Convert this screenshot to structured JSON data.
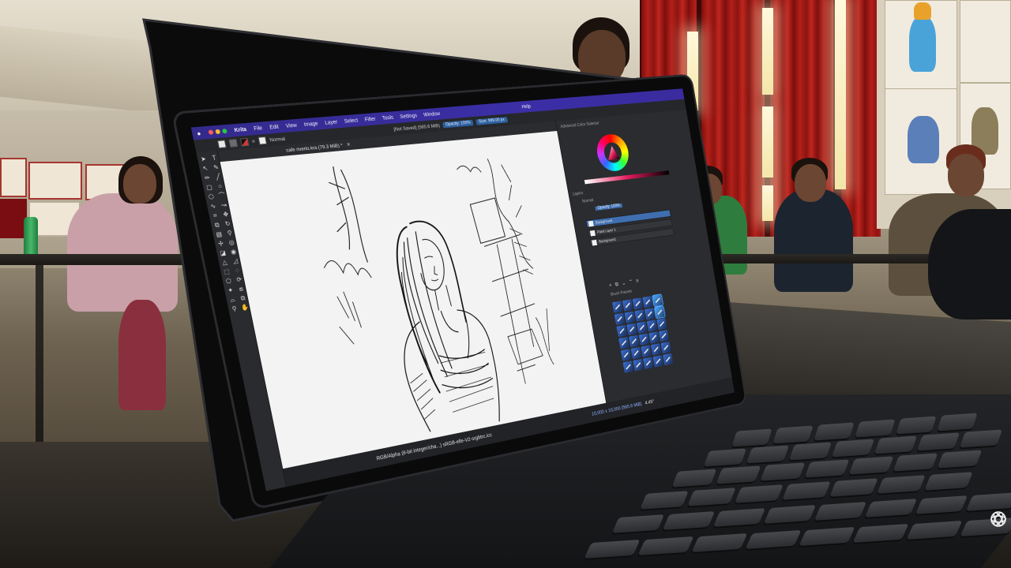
{
  "krita": {
    "menubar": {
      "apple_icon": "apple-logo-icon",
      "items": [
        "Krita",
        "File",
        "Edit",
        "View",
        "Image",
        "Layer",
        "Select",
        "Filter",
        "Tools",
        "Settings",
        "Window",
        "Help"
      ]
    },
    "toolbar": {
      "blend_mode": "Normal",
      "doc_status": "[Not Saved]  (565.6 MiB)",
      "opacity": "Opacity: 100%",
      "size": "Size: 999.00 px"
    },
    "document": {
      "title": "cafe riverio.kra (79.3 MiB) *",
      "close": "✕"
    },
    "status_bar": {
      "color_profile": "RGB/Alpha (8-bit integer/cha...)  sRGB-elle-V2-srgbtrc.icc",
      "canvas_size": "10,000 x 10,000 (565.6 MiB)",
      "zoom": "4.45°"
    },
    "dockers": {
      "advanced_color_selector": "Advanced Color Selector",
      "layers_title": "Layers",
      "blend_label": "Normal",
      "opacity_label": "Opacity: 100%",
      "layers": [
        "Background",
        "Paint Layer 1",
        "Background"
      ],
      "brush_presets_title": "Brush Presets"
    },
    "accent_colors": {
      "menubar": "#3b2fa6",
      "selection": "#3f6fb0",
      "canvas": "#f4f3f3"
    }
  },
  "scene": {
    "watermark_icon": "app-logo-icon"
  }
}
